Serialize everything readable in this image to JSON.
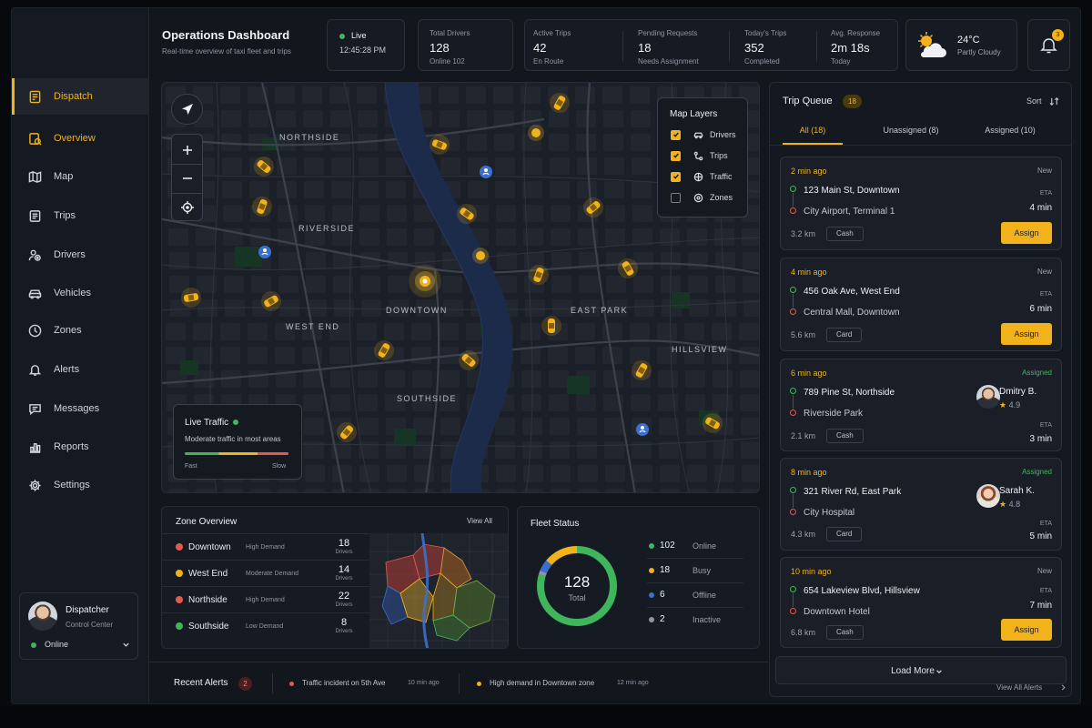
{
  "header": {
    "title": "Operations Dashboard",
    "subtitle": "Real-time overview of taxi fleet and trips"
  },
  "live": {
    "label": "Live",
    "time": "12:45:28 PM"
  },
  "stats": [
    {
      "label": "Total Drivers",
      "value": "128",
      "sub": "Online 102"
    },
    {
      "label": "Active Trips",
      "value": "42",
      "sub": "En Route"
    },
    {
      "label": "Pending Requests",
      "value": "18",
      "sub": "Needs Assignment"
    },
    {
      "label": "Today's Trips",
      "value": "352",
      "sub": "Completed"
    },
    {
      "label": "Avg. Response",
      "value": "2m 18s",
      "sub": "Today"
    }
  ],
  "weather": {
    "temp": "24°C",
    "desc": "Partly Cloudy",
    "icon": "partly-cloudy-icon"
  },
  "notifications": {
    "count": "3"
  },
  "sidebar": {
    "items": [
      {
        "label": "Dispatch",
        "icon": "dispatch-icon"
      },
      {
        "label": "Overview",
        "icon": "overview-icon"
      },
      {
        "label": "Map",
        "icon": "map-icon"
      },
      {
        "label": "Trips",
        "icon": "trips-icon"
      },
      {
        "label": "Drivers",
        "icon": "drivers-icon"
      },
      {
        "label": "Vehicles",
        "icon": "vehicle-icon"
      },
      {
        "label": "Zones",
        "icon": "zones-icon"
      },
      {
        "label": "Alerts",
        "icon": "bell-icon"
      },
      {
        "label": "Messages",
        "icon": "message-icon"
      },
      {
        "label": "Reports",
        "icon": "reports-icon"
      },
      {
        "label": "Settings",
        "icon": "gear-icon"
      }
    ]
  },
  "user": {
    "name": "Dispatcher",
    "role": "Control Center",
    "status": "Online"
  },
  "map": {
    "labels": [
      "NORTHSIDE",
      "RIVERSIDE",
      "WEST END",
      "DOWNTOWN",
      "EAST PARK",
      "HILLSVIEW",
      "SOUTHSIDE"
    ],
    "layers": {
      "title": "Map Layers",
      "items": [
        {
          "label": "Drivers",
          "checked": true
        },
        {
          "label": "Trips",
          "checked": true
        },
        {
          "label": "Traffic",
          "checked": true
        },
        {
          "label": "Zones",
          "checked": false
        }
      ]
    },
    "traffic": {
      "title": "Live Traffic",
      "desc": "Moderate traffic in most areas",
      "fast": "Fast",
      "slow": "Slow"
    }
  },
  "zones": {
    "title": "Zone Overview",
    "view_all": "View All",
    "unit": "Drivers",
    "rows": [
      {
        "name": "Downtown",
        "demand": "High Demand",
        "count": "18",
        "color": "#e05a4f"
      },
      {
        "name": "West End",
        "demand": "Moderate Demand",
        "count": "14",
        "color": "#f2b21b"
      },
      {
        "name": "Northside",
        "demand": "High Demand",
        "count": "22",
        "color": "#e05a4f"
      },
      {
        "name": "Southside",
        "demand": "Low Demand",
        "count": "8",
        "color": "#3fb65c"
      }
    ]
  },
  "fleet": {
    "title": "Fleet Status",
    "total": "128",
    "total_label": "Total",
    "rows": [
      {
        "count": "102",
        "label": "Online",
        "color": "#3fb65c",
        "value": 102
      },
      {
        "count": "18",
        "label": "Busy",
        "color": "#f2b21b",
        "value": 18
      },
      {
        "count": "6",
        "label": "Offline",
        "color": "#3b6fd1",
        "value": 6
      },
      {
        "count": "2",
        "label": "Inactive",
        "color": "#8e96a3",
        "value": 2
      }
    ]
  },
  "alerts": {
    "title": "Recent Alerts",
    "count": "2",
    "items": [
      {
        "text": "Traffic incident on 5th Ave",
        "time": "10 min ago",
        "color": "#e05a4f"
      },
      {
        "text": "High demand in Downtown zone",
        "time": "12 min ago",
        "color": "#f2b21b"
      }
    ]
  },
  "queue": {
    "title": "Trip Queue",
    "count": "18",
    "sort": "Sort",
    "tabs": [
      "All (18)",
      "Unassigned (8)",
      "Assigned (10)"
    ],
    "eta_label": "ETA",
    "assign": "Assign",
    "load_more": "Load More",
    "view_all_alerts": "View All Alerts",
    "trips": [
      {
        "time": "2 min ago",
        "status": "New",
        "from": "123 Main  St, Downtown",
        "to": "City Airport, Terminal 1",
        "dist": "3.2 km",
        "pay": "Cash",
        "eta": "4 min"
      },
      {
        "time": "4 min ago",
        "status": "New",
        "from": "456 Oak Ave, West End",
        "to": "Central Mall, Downtown",
        "dist": "5.6 km",
        "pay": "Card",
        "eta": "6 min"
      },
      {
        "time": "6 min ago",
        "status": "Assigned",
        "from": "789 Pine St, Northside",
        "to": "Riverside Park",
        "dist": "2.1 km",
        "pay": "Cash",
        "eta": "3 min",
        "driver": "Dmitry B.",
        "rating": "4.9"
      },
      {
        "time": "8 min ago",
        "status": "Assigned",
        "from": "321 River Rd, East Park",
        "to": "City Hospital",
        "dist": "4.3 km",
        "pay": "Card",
        "eta": "5 min",
        "driver": "Sarah K.",
        "rating": "4.8"
      },
      {
        "time": "10 min ago",
        "status": "New",
        "from": "654 Lakeview Blvd, Hillsview",
        "to": "Downtown Hotel",
        "dist": "6.8 km",
        "pay": "Cash",
        "eta": "7 min"
      }
    ]
  }
}
